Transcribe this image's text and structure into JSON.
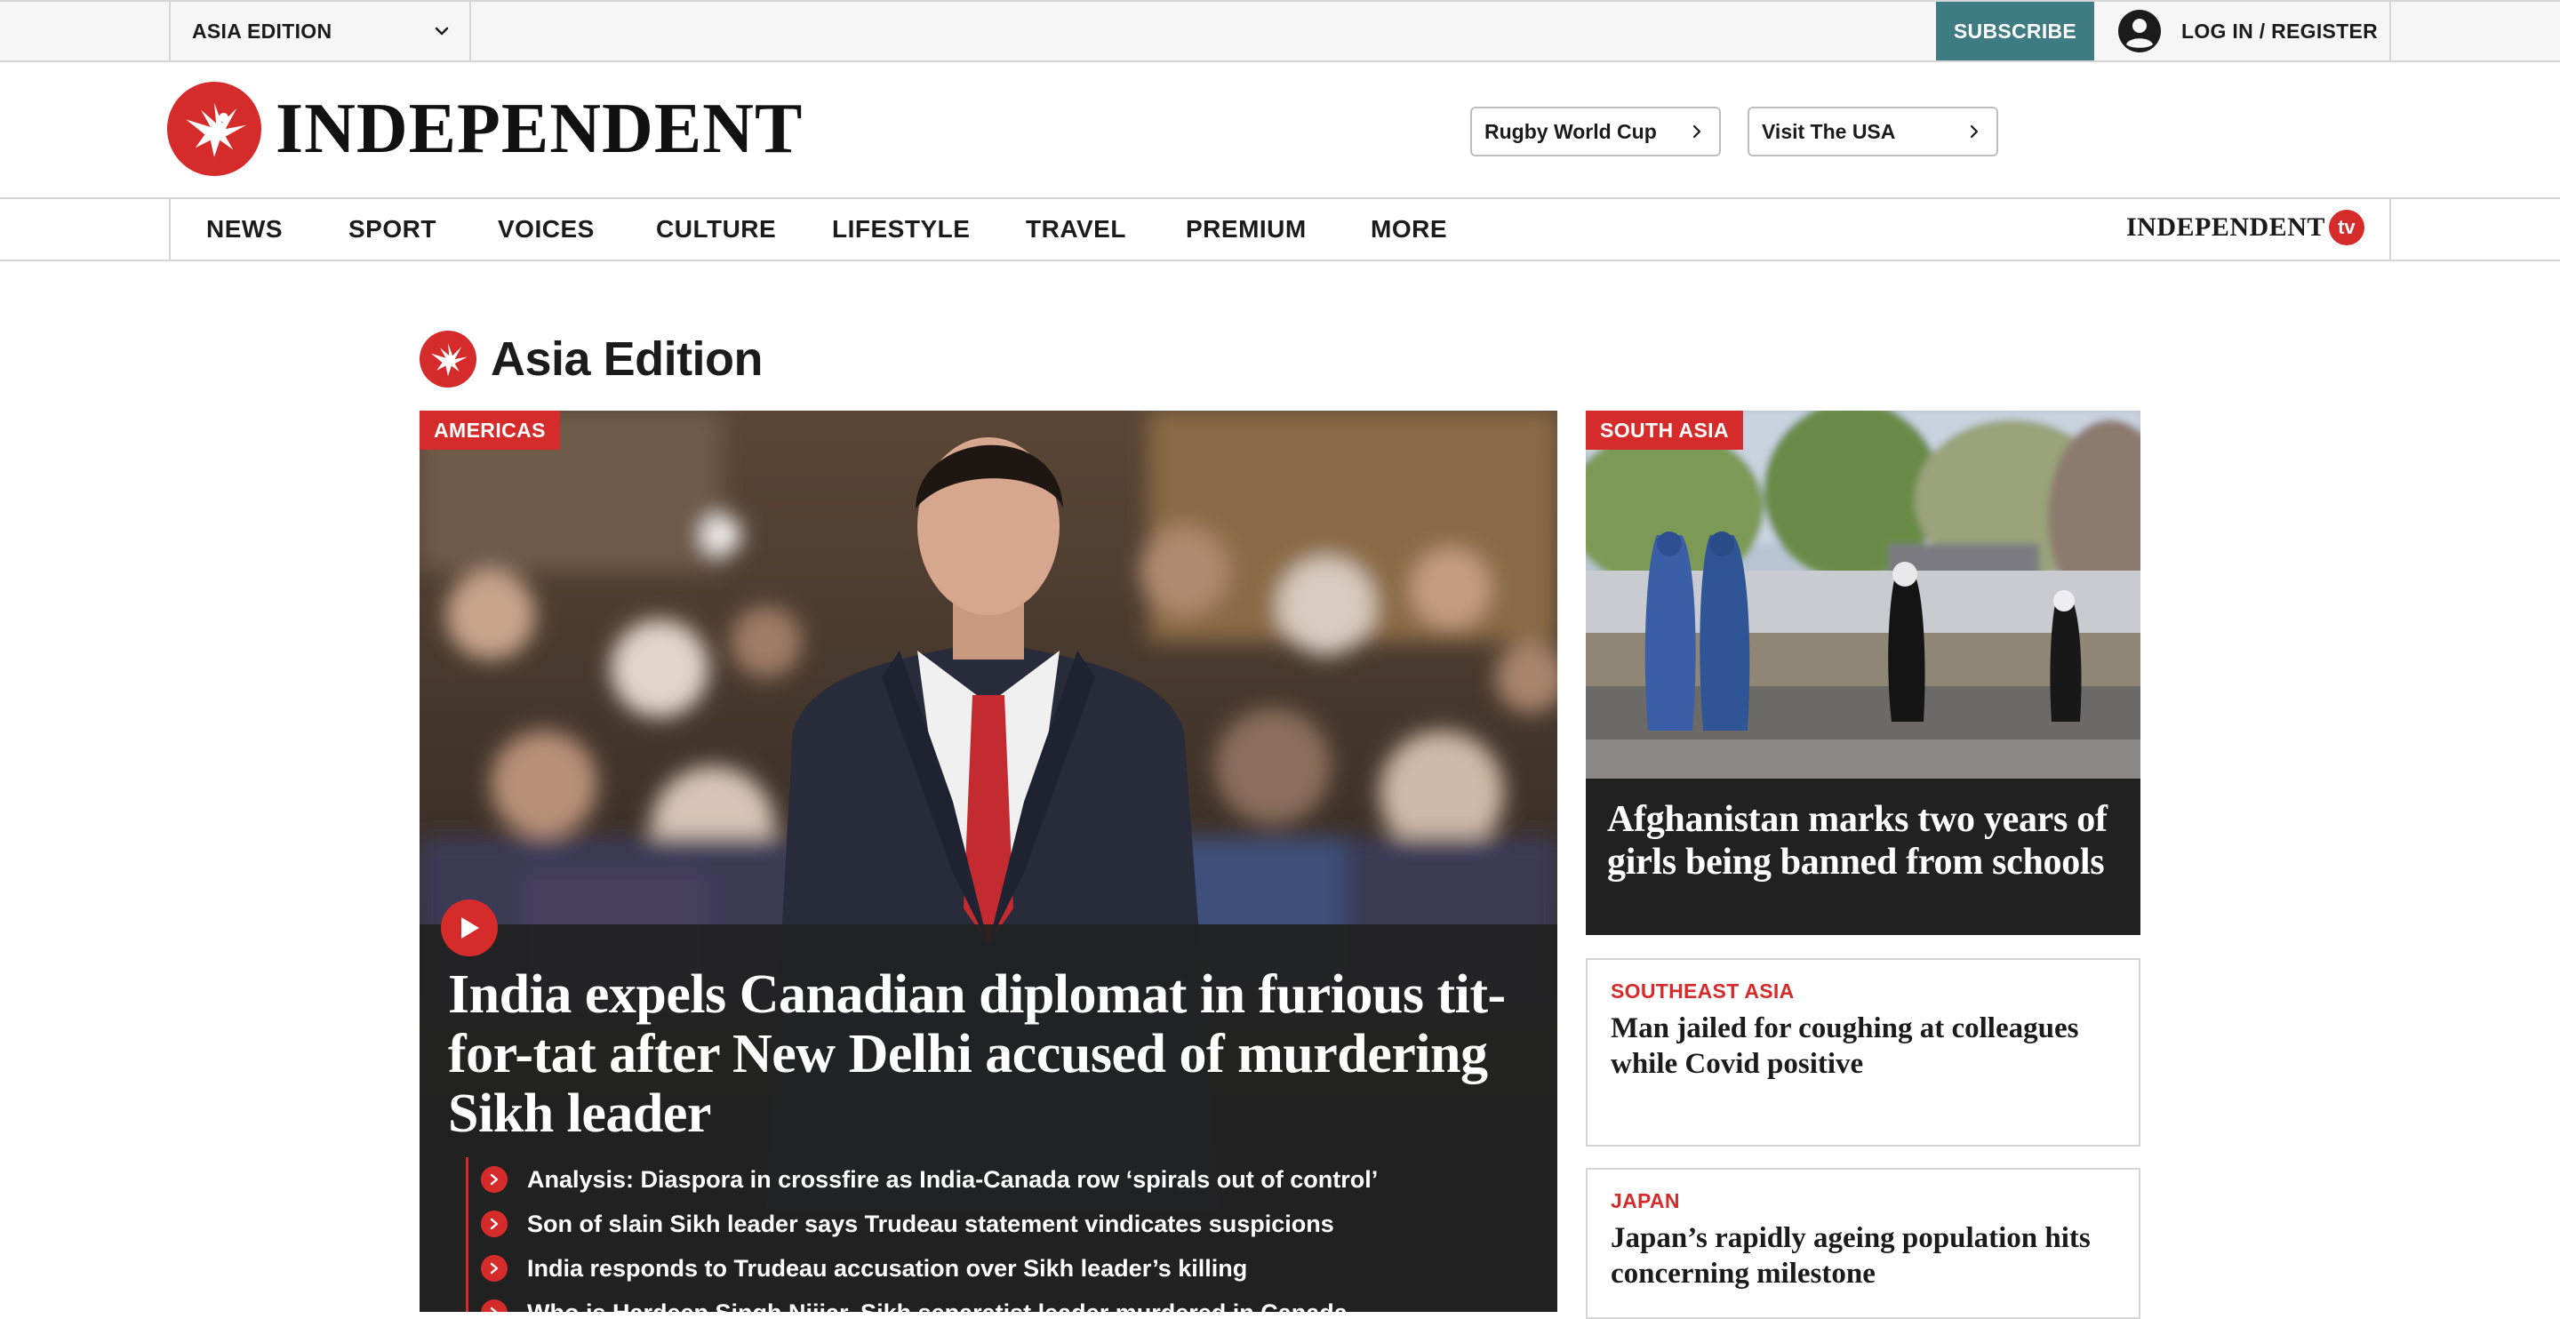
{
  "utility": {
    "edition_label": "ASIA EDITION",
    "subscribe_label": "SUBSCRIBE",
    "login_label": "LOG IN / REGISTER"
  },
  "masthead": {
    "wordmark": "INDEPENDENT",
    "topic_pills": [
      {
        "label": "Rugby World Cup"
      },
      {
        "label": "Visit The USA"
      }
    ]
  },
  "nav": {
    "items": [
      {
        "label": "NEWS"
      },
      {
        "label": "SPORT"
      },
      {
        "label": "VOICES"
      },
      {
        "label": "CULTURE"
      },
      {
        "label": "LIFESTYLE"
      },
      {
        "label": "TRAVEL"
      },
      {
        "label": "PREMIUM"
      },
      {
        "label": "MORE"
      }
    ],
    "independent_tv": {
      "word": "INDEPENDENT",
      "tv": "tv"
    }
  },
  "page": {
    "title": "Asia Edition"
  },
  "lead": {
    "tag": "AMERICAS",
    "headline": "India expels Canadian diplomat in furious tit-for-tat after New Delhi accused of murdering Sikh leader",
    "related": [
      {
        "text": "Analysis: Diaspora in crossfire as India-Canada row ‘spirals out of control’"
      },
      {
        "text": "Son of slain Sikh leader says Trudeau statement vindicates suspicions"
      },
      {
        "text": "India responds to Trudeau accusation over Sikh leader’s killing"
      },
      {
        "text": "Who is Hardeep Singh Nijjar, Sikh separatist leader murdered in Canada"
      }
    ]
  },
  "side": {
    "feature": {
      "tag": "SOUTH ASIA",
      "headline": "Afghanistan marks two years of girls being banned from schools"
    },
    "cards": [
      {
        "kicker": "SOUTHEAST ASIA",
        "headline": "Man jailed for coughing at colleagues while Covid positive"
      },
      {
        "kicker": "JAPAN",
        "headline": "Japan’s rapidly ageing population hits concerning milestone"
      }
    ]
  },
  "colors": {
    "brand_red": "#d52b2b",
    "subscribe_teal": "#3e7b83",
    "overlay_dark": "#212121"
  },
  "icons": {
    "edition_dropdown": "chevron-down-icon",
    "account": "user-circle-icon",
    "pill_arrow": "chevron-right-icon",
    "play": "play-icon",
    "related_bullet": "chevron-right-icon",
    "logo": "eagle-icon"
  }
}
